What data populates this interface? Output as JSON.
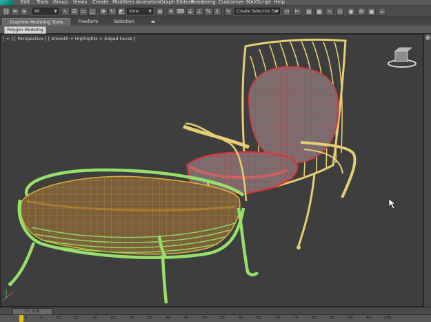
{
  "menu": {
    "items": [
      "Edit",
      "Tools",
      "Group",
      "Views",
      "Create",
      "Modifiers",
      "Animation",
      "Graph Editors",
      "Rendering",
      "Customize",
      "MAXScript",
      "Help"
    ]
  },
  "toolbar": {
    "selection_filter": "All",
    "reference_coord": "View",
    "selection_set": "Create Selection Se"
  },
  "ribbon": {
    "tabs": [
      "Graphite Modeling Tools",
      "Freeform",
      "Selection"
    ],
    "panel_button": "Polygon Modeling"
  },
  "viewport": {
    "label": "[ + ] [ Perspective ] [ Smooth + Highlights + Edged Faces ]"
  },
  "timeline": {
    "frame_display": "0 / 100",
    "ticks": [
      "0",
      "5",
      "10",
      "15",
      "20",
      "25",
      "30",
      "35",
      "40",
      "45",
      "50",
      "55",
      "60",
      "65",
      "70",
      "75",
      "80",
      "85",
      "90",
      "95",
      "100"
    ]
  }
}
